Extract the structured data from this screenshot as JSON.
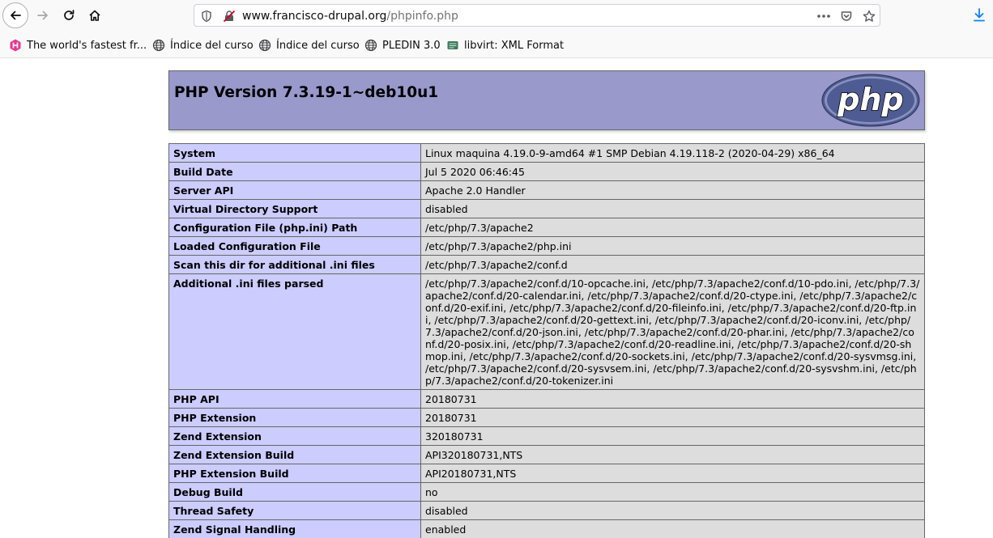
{
  "browser": {
    "url_host": "www.francisco-drupal.org",
    "url_path": "/phpinfo.php",
    "bookmarks": [
      {
        "label": "The world's fastest fr...",
        "icon": "hexagon-h-icon"
      },
      {
        "label": "Índice del curso",
        "icon": "globe-icon"
      },
      {
        "label": "Índice del curso",
        "icon": "globe-icon"
      },
      {
        "label": "PLEDIN 3.0",
        "icon": "globe-icon"
      },
      {
        "label": "libvirt: XML Format",
        "icon": "libvirt-icon"
      }
    ],
    "accent_color": "#0a84ff"
  },
  "page": {
    "title": "PHP Version 7.3.19-1~deb10u1",
    "logo_text": "php",
    "header_color": "#9999cc",
    "rows": [
      {
        "label": "System",
        "value": "Linux maquina 4.19.0-9-amd64 #1 SMP Debian 4.19.118-2 (2020-04-29) x86_64"
      },
      {
        "label": "Build Date",
        "value": "Jul 5 2020 06:46:45"
      },
      {
        "label": "Server API",
        "value": "Apache 2.0 Handler"
      },
      {
        "label": "Virtual Directory Support",
        "value": "disabled"
      },
      {
        "label": "Configuration File (php.ini) Path",
        "value": "/etc/php/7.3/apache2"
      },
      {
        "label": "Loaded Configuration File",
        "value": "/etc/php/7.3/apache2/php.ini"
      },
      {
        "label": "Scan this dir for additional .ini files",
        "value": "/etc/php/7.3/apache2/conf.d"
      },
      {
        "label": "Additional .ini files parsed",
        "value": "/etc/php/7.3/apache2/conf.d/10-opcache.ini, /etc/php/7.3/apache2/conf.d/10-pdo.ini, /etc/php/7.3/apache2/conf.d/20-calendar.ini, /etc/php/7.3/apache2/conf.d/20-ctype.ini, /etc/php/7.3/apache2/conf.d/20-exif.ini, /etc/php/7.3/apache2/conf.d/20-fileinfo.ini, /etc/php/7.3/apache2/conf.d/20-ftp.ini, /etc/php/7.3/apache2/conf.d/20-gettext.ini, /etc/php/7.3/apache2/conf.d/20-iconv.ini, /etc/php/7.3/apache2/conf.d/20-json.ini, /etc/php/7.3/apache2/conf.d/20-phar.ini, /etc/php/7.3/apache2/conf.d/20-posix.ini, /etc/php/7.3/apache2/conf.d/20-readline.ini, /etc/php/7.3/apache2/conf.d/20-shmop.ini, /etc/php/7.3/apache2/conf.d/20-sockets.ini, /etc/php/7.3/apache2/conf.d/20-sysvmsg.ini, /etc/php/7.3/apache2/conf.d/20-sysvsem.ini, /etc/php/7.3/apache2/conf.d/20-sysvshm.ini, /etc/php/7.3/apache2/conf.d/20-tokenizer.ini"
      },
      {
        "label": "PHP API",
        "value": "20180731"
      },
      {
        "label": "PHP Extension",
        "value": "20180731"
      },
      {
        "label": "Zend Extension",
        "value": "320180731"
      },
      {
        "label": "Zend Extension Build",
        "value": "API320180731,NTS"
      },
      {
        "label": "PHP Extension Build",
        "value": "API20180731,NTS"
      },
      {
        "label": "Debug Build",
        "value": "no"
      },
      {
        "label": "Thread Safety",
        "value": "disabled"
      },
      {
        "label": "Zend Signal Handling",
        "value": "enabled"
      }
    ]
  }
}
